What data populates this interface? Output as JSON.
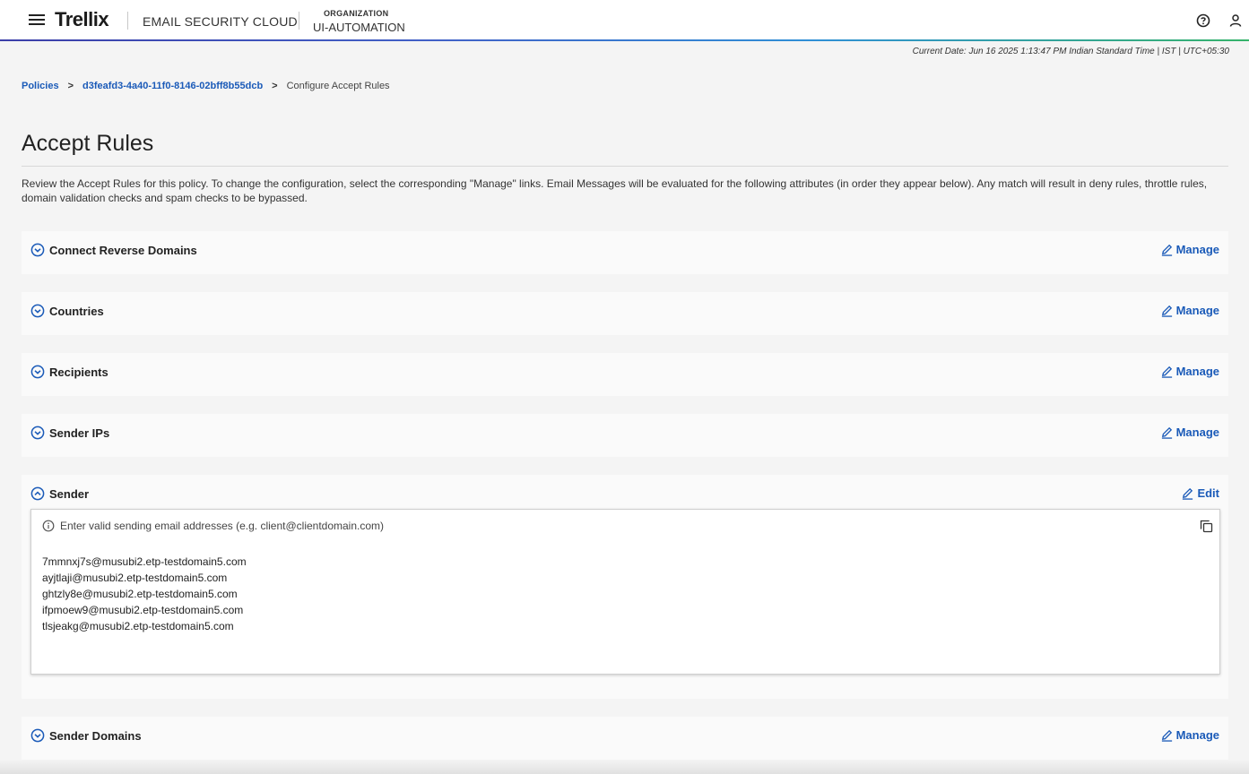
{
  "header": {
    "logo": "Trellix",
    "product": "EMAIL SECURITY CLOUD",
    "org_label": "ORGANIZATION",
    "org_value": "UI-AUTOMATION"
  },
  "current_date": "Current Date: Jun 16 2025 1:13:47 PM Indian Standard Time | IST | UTC+05:30",
  "breadcrumb": {
    "items": [
      "Policies",
      "d3feafd3-4a40-11f0-8146-02bff8b55dcb",
      "Configure Accept Rules"
    ],
    "separator": ">"
  },
  "page": {
    "title": "Accept Rules",
    "description": "Review the Accept Rules for this policy. To change the configuration, select the corresponding \"Manage\" links. Email Messages will be evaluated for the following attributes (in order they appear below). Any match will result in deny rules, throttle rules, domain validation checks and spam checks to be bypassed."
  },
  "sections": [
    {
      "title": "Connect Reverse Domains",
      "action": "Manage"
    },
    {
      "title": "Countries",
      "action": "Manage"
    },
    {
      "title": "Recipients",
      "action": "Manage"
    },
    {
      "title": "Sender IPs",
      "action": "Manage"
    },
    {
      "title": "Sender",
      "action": "Edit"
    },
    {
      "title": "Sender Domains",
      "action": "Manage"
    }
  ],
  "sender_panel": {
    "info": "Enter valid sending email addresses (e.g. client@clientdomain.com)",
    "emails": [
      "7mmnxj7s@musubi2.etp-testdomain5.com",
      "ayjtlaji@musubi2.etp-testdomain5.com",
      "ghtzly8e@musubi2.etp-testdomain5.com",
      "ifpmoew9@musubi2.etp-testdomain5.com",
      "tlsjeakg@musubi2.etp-testdomain5.com"
    ]
  },
  "colors": {
    "link": "#1a5ab8",
    "background": "#f4f4f4",
    "panel": "#fafafa"
  }
}
